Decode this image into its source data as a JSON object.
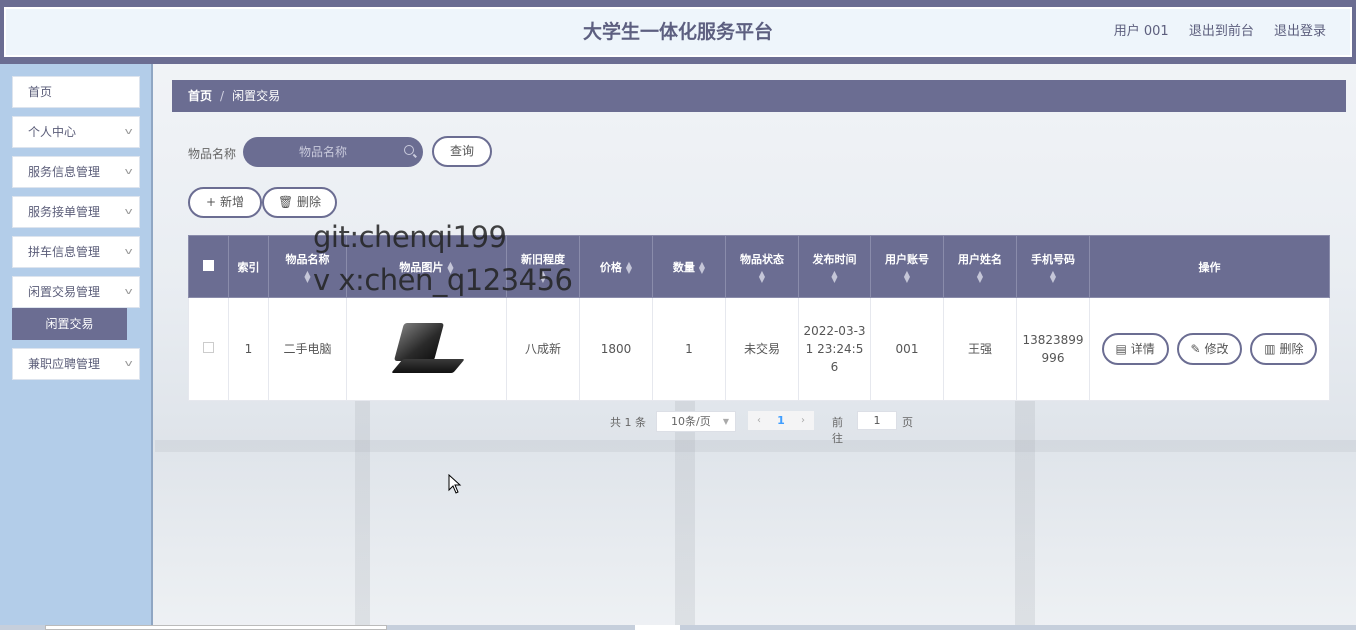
{
  "header": {
    "title": "大学生一体化服务平台",
    "user": "用户 001",
    "to_front": "退出到前台",
    "logout": "退出登录"
  },
  "sidebar": {
    "items": [
      {
        "label": "首页",
        "has_chevron": false
      },
      {
        "label": "个人中心",
        "has_chevron": true
      },
      {
        "label": "服务信息管理",
        "has_chevron": true
      },
      {
        "label": "服务接单管理",
        "has_chevron": true
      },
      {
        "label": "拼车信息管理",
        "has_chevron": true
      },
      {
        "label": "闲置交易管理",
        "has_chevron": true
      },
      {
        "label": "兼职应聘管理",
        "has_chevron": true
      }
    ],
    "active_sub": "闲置交易"
  },
  "breadcrumb": {
    "home": "首页",
    "sep": "/",
    "current": "闲置交易"
  },
  "search": {
    "label": "物品名称",
    "placeholder": "物品名称",
    "query_button": "查询"
  },
  "actions": {
    "add": "新增",
    "delete": "删除",
    "add_icon": "plus-icon",
    "delete_icon": "trash-icon"
  },
  "table": {
    "columns": [
      "索引",
      "物品名称",
      "物品图片",
      "新旧程度",
      "价格",
      "数量",
      "物品状态",
      "发布时间",
      "用户账号",
      "用户姓名",
      "手机号码",
      "操作"
    ],
    "rows": [
      {
        "index": "1",
        "name": "二手电脑",
        "image": "laptop",
        "condition": "八成新",
        "price": "1800",
        "quantity": "1",
        "status": "未交易",
        "time": "2022-03-31 23:24:56",
        "account": "001",
        "username": "王强",
        "phone": "13823899996",
        "btn_detail": "详情",
        "btn_edit": "修改",
        "btn_delete": "删除"
      }
    ]
  },
  "pagination": {
    "total": "共 1 条",
    "page_size": "10条/页",
    "current": "1",
    "goto_label": "前往",
    "goto_value": "1",
    "page_unit": "页"
  },
  "watermark": {
    "line1": "git:chenqi199",
    "line2": "v x:chen_q123456"
  },
  "colors": {
    "primary": "#6b6d92",
    "sidebar": "#b3cde9",
    "header_bg": "#eef5fb"
  }
}
